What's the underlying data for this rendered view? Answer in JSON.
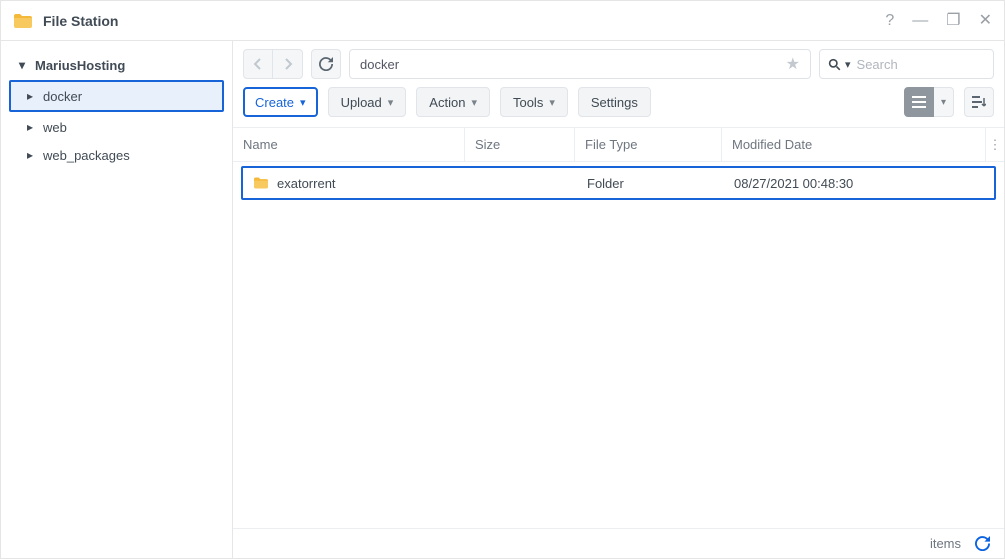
{
  "app": {
    "title": "File Station"
  },
  "sidebar": {
    "root": {
      "label": "MariusHosting",
      "expanded": true
    },
    "items": [
      {
        "label": "docker",
        "selected": true,
        "hasChildren": true
      },
      {
        "label": "web",
        "selected": false,
        "hasChildren": true
      },
      {
        "label": "web_packages",
        "selected": false,
        "hasChildren": true
      }
    ]
  },
  "path": {
    "current": "docker"
  },
  "search": {
    "placeholder": "Search"
  },
  "toolbar": {
    "create": "Create",
    "upload": "Upload",
    "action": "Action",
    "tools": "Tools",
    "settings": "Settings"
  },
  "columns": {
    "name": "Name",
    "size": "Size",
    "type": "File Type",
    "date": "Modified Date"
  },
  "rows": [
    {
      "name": "exatorrent",
      "size": "",
      "type": "Folder",
      "date": "08/27/2021 00:48:30"
    }
  ],
  "status": {
    "items_label": "items"
  }
}
